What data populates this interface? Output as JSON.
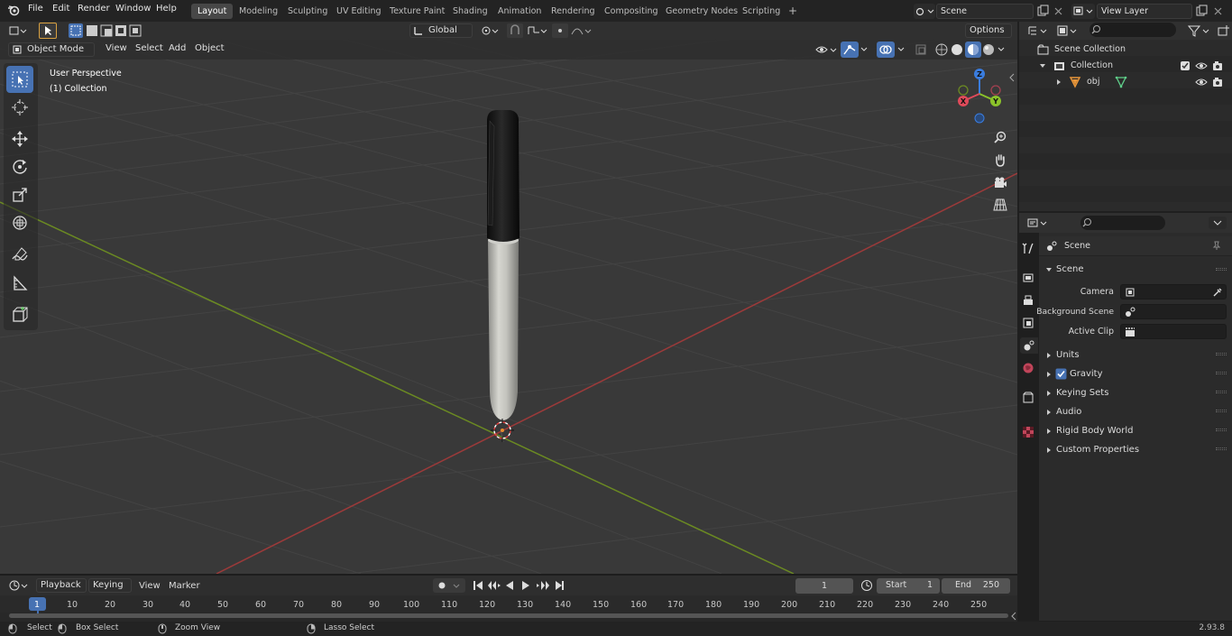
{
  "menu": [
    "File",
    "Edit",
    "Render",
    "Window",
    "Help"
  ],
  "workspaces": {
    "active": "Layout",
    "tabs": [
      "Layout",
      "Modeling",
      "Sculpting",
      "UV Editing",
      "Texture Paint",
      "Shading",
      "Animation",
      "Rendering",
      "Compositing",
      "Geometry Nodes",
      "Scripting"
    ],
    "add": "+"
  },
  "scene_field": "Scene",
  "view_layer_field": "View Layer",
  "tool_header": {
    "transform_orientation": "Global",
    "options": "Options"
  },
  "viewport_header": {
    "mode": "Object Mode",
    "view": "View",
    "select": "Select",
    "add": "Add",
    "object": "Object"
  },
  "viewport": {
    "perspective_label": "User Perspective",
    "collection_label": "(1) Collection",
    "gizmo": {
      "x": "X",
      "y": "Y",
      "z": "Z"
    }
  },
  "outliner": {
    "scene_collection": "Scene Collection",
    "collection": "Collection",
    "object": "obj"
  },
  "properties": {
    "context": "Scene",
    "panel_title": "Scene",
    "camera_label": "Camera",
    "background_scene_label": "Background Scene",
    "active_clip_label": "Active Clip",
    "sections": [
      "Units",
      "Gravity",
      "Keying Sets",
      "Audio",
      "Rigid Body World",
      "Custom Properties"
    ],
    "gravity_checked": true
  },
  "timeline": {
    "playback": "Playback",
    "keying": "Keying",
    "view": "View",
    "marker": "Marker",
    "current_frame": "1",
    "start_label": "Start",
    "start_value": "1",
    "end_label": "End",
    "end_value": "250",
    "ticks": [
      "1",
      "10",
      "20",
      "30",
      "40",
      "50",
      "60",
      "70",
      "80",
      "90",
      "100",
      "110",
      "120",
      "130",
      "140",
      "150",
      "160",
      "170",
      "180",
      "190",
      "200",
      "210",
      "220",
      "230",
      "240",
      "250"
    ]
  },
  "status_bar": {
    "select": "Select",
    "box_select": "Box Select",
    "zoom_view": "Zoom View",
    "lasso_select": "Lasso Select",
    "version": "2.93.8"
  },
  "colors": {
    "accent": "#4772b3",
    "x_axis": "#9b3a3a",
    "y_axis": "#6b8a22",
    "gizmo_x": "#e04a5a",
    "gizmo_y": "#8bc22a",
    "gizmo_z": "#3a7de0",
    "object_orange": "#e8963a"
  }
}
